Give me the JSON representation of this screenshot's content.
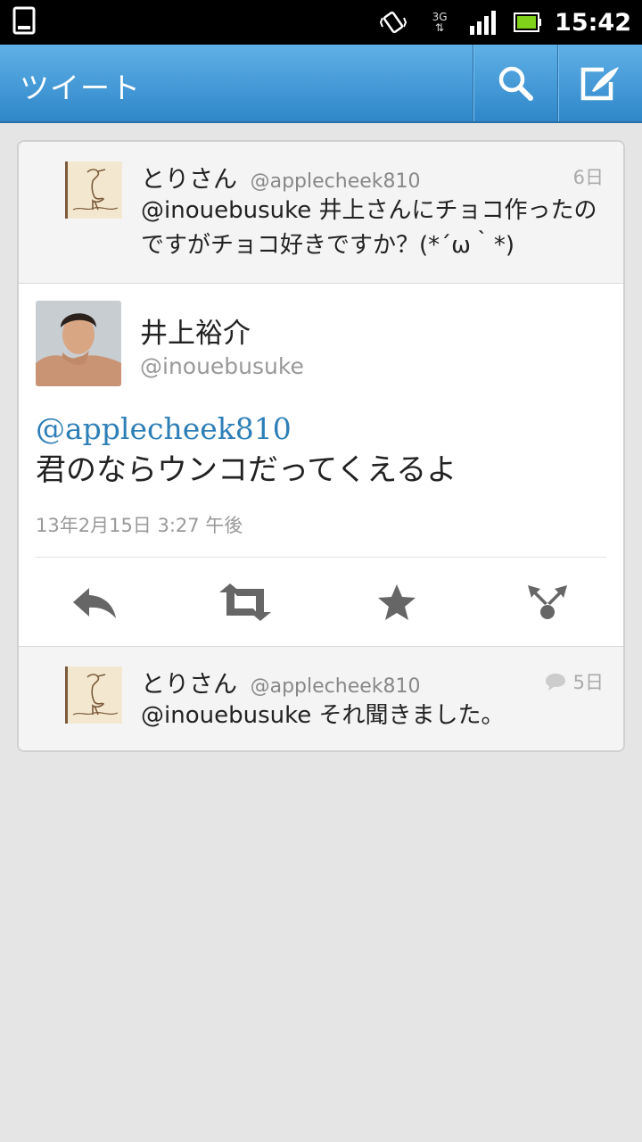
{
  "status_bar": {
    "time": "15:42",
    "network": "3G"
  },
  "action_bar": {
    "title": "ツイート",
    "search_icon": "search-icon",
    "compose_icon": "compose-icon"
  },
  "in_reply_to": {
    "name": "とりさん",
    "handle": "@applecheek810",
    "time": "6日",
    "text": "@inouebusuke 井上さんにチョコ作ったのですがチョコ好きですか？(*´ω｀*)"
  },
  "tweet": {
    "name": "井上裕介",
    "handle": "@inouebusuke",
    "mention": "@applecheek810",
    "text": "君のならウンコだってくえるよ",
    "date": "13年2月15日 3:27 午後",
    "actions": [
      "reply-icon",
      "retweet-icon",
      "star-icon",
      "share-icon"
    ]
  },
  "reply": {
    "name": "とりさん",
    "handle": "@applecheek810",
    "time": "5日",
    "text": "@inouebusuke それ聞きました。"
  },
  "colors": {
    "action_bar": "#3d99d8",
    "mention": "#2d7fb7",
    "icon_gray": "#666666"
  }
}
